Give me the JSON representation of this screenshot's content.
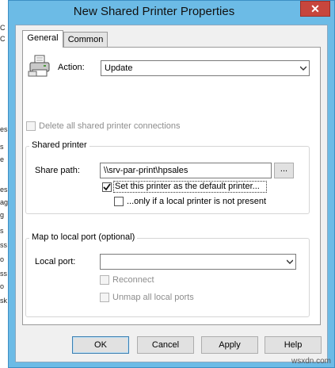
{
  "window": {
    "title": "New Shared Printer Properties",
    "close_glyph": "✕"
  },
  "background": {
    "fragments": [
      "C",
      "C",
      "es",
      "s",
      "e",
      "es",
      "ag",
      "g",
      "s",
      "ss",
      "o",
      "ss",
      "o",
      "sk"
    ]
  },
  "tabs": [
    {
      "label": "General",
      "active": true
    },
    {
      "label": "Common",
      "active": false
    }
  ],
  "action": {
    "label": "Action:",
    "value": "Update",
    "icon": "printer-icon"
  },
  "delete_all": {
    "label": "Delete all shared printer connections",
    "checked": false,
    "enabled": false
  },
  "shared_printer": {
    "group_title": "Shared printer",
    "share_path_label": "Share path:",
    "share_path_value": "\\\\srv-par-print\\hpsales",
    "browse_label": "...",
    "set_default": {
      "label": "Set this printer as the default printer...",
      "checked": true
    },
    "only_if_local": {
      "label": "...only if a local printer is not present",
      "checked": false
    }
  },
  "map_local": {
    "group_title": "Map to local port (optional)",
    "local_port_label": "Local port:",
    "local_port_value": "",
    "reconnect": {
      "label": "Reconnect",
      "checked": false,
      "enabled": false
    },
    "unmap": {
      "label": "Unmap all local ports",
      "checked": false,
      "enabled": false
    }
  },
  "buttons": {
    "ok": "OK",
    "cancel": "Cancel",
    "apply": "Apply",
    "help": "Help"
  },
  "watermark": "wsxdn.com",
  "colors": {
    "title_bar": "#6cbbe6",
    "close_button": "#c7463d",
    "dialog_bg": "#f0f0f0"
  }
}
